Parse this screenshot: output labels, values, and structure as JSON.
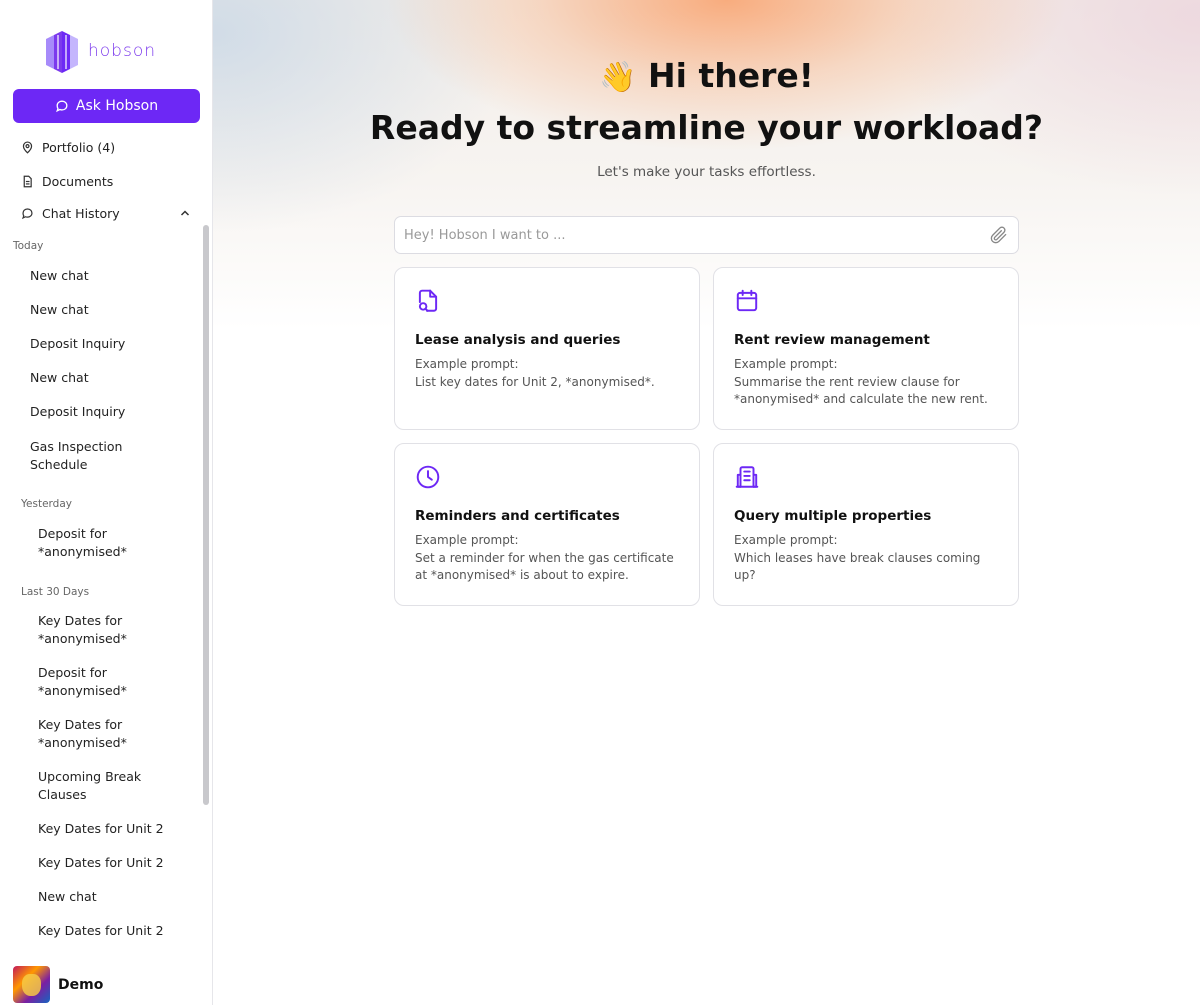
{
  "brand": {
    "logo_text": "hobson",
    "accent": "#6d28f5"
  },
  "sidebar": {
    "ask_button": "Ask Hobson",
    "nav": [
      {
        "label": "Portfolio (4)",
        "icon": "map-pin-icon"
      },
      {
        "label": "Documents",
        "icon": "document-icon"
      },
      {
        "label": "Chat History",
        "icon": "chat-bubble-icon"
      }
    ],
    "sections": {
      "today": "Today",
      "yesterday": "Yesterday",
      "last30": "Last 30 Days"
    },
    "today_chats": [
      "New chat",
      "New chat",
      "Deposit Inquiry",
      "New chat",
      "Deposit Inquiry",
      "Gas Inspection Schedule"
    ],
    "yesterday_chats": [
      "Deposit for *anonymised*"
    ],
    "last30_chats": [
      "Key Dates for *anonymised*",
      "Deposit for *anonymised*",
      "Key Dates for *anonymised*",
      "Upcoming Break Clauses",
      "Key Dates for Unit 2",
      "Key Dates for Unit 2",
      "New chat",
      "Key Dates for Unit 2"
    ],
    "user": {
      "name": "Demo"
    }
  },
  "main": {
    "greeting_emoji": "👋",
    "greeting": "Hi there!",
    "title": "Ready to streamline your workload?",
    "subtitle": "Let's make your tasks effortless.",
    "search": {
      "placeholder": "Hey! Hobson I want to ..."
    },
    "cards": [
      {
        "icon": "document-search-icon",
        "title": "Lease analysis and queries",
        "label": "Example prompt:",
        "text": "List key dates for Unit 2, *anonymised*."
      },
      {
        "icon": "calendar-icon",
        "title": "Rent review management",
        "label": "Example prompt:",
        "text": "Summarise the rent review clause for *anonymised* and calculate the new rent."
      },
      {
        "icon": "clock-icon",
        "title": "Reminders and certificates",
        "label": "Example prompt:",
        "text": "Set a reminder for when the gas certificate at *anonymised* is about to expire."
      },
      {
        "icon": "building-icon",
        "title": "Query multiple properties",
        "label": "Example prompt:",
        "text": "Which leases have break clauses coming up?"
      }
    ]
  }
}
